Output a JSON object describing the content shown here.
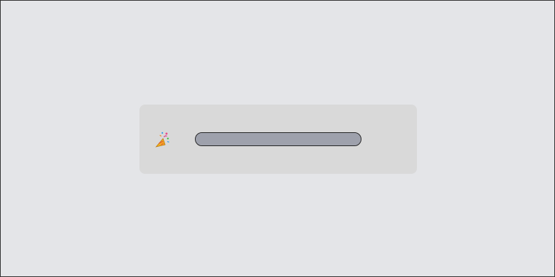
{
  "card": {
    "icon": "party-popper-icon",
    "progress": {
      "value_percent": 100,
      "track_color": "#9ea1ac",
      "fill_color": "#9ea1ac"
    }
  },
  "colors": {
    "page_background": "#e4e5e8",
    "card_background": "#d9d9d9",
    "border": "#1f1f1f"
  }
}
